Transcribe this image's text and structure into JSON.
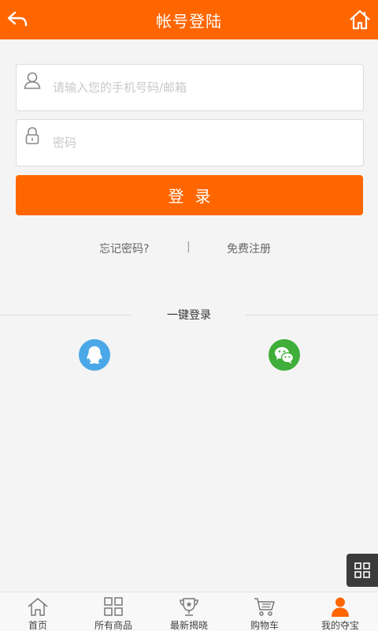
{
  "header": {
    "title": "帐号登陆",
    "back_icon": "back-arrow-icon",
    "home_icon": "home-icon"
  },
  "form": {
    "username": {
      "value": "",
      "placeholder": "请输入您的手机号码/邮箱",
      "icon": "user-icon"
    },
    "password": {
      "value": "",
      "placeholder": "密码",
      "icon": "lock-icon"
    },
    "login_label": "登录"
  },
  "links": {
    "forgot_label": "忘记密码?",
    "separator": "|",
    "register_label": "免费注册"
  },
  "social": {
    "title": "一键登录",
    "providers": [
      {
        "name": "qq",
        "icon": "qq-icon",
        "color": "#4aa8e8"
      },
      {
        "name": "wechat",
        "icon": "wechat-icon",
        "color": "#3fae3a"
      }
    ]
  },
  "floating": {
    "icon": "grid-icon"
  },
  "tabbar": {
    "items": [
      {
        "label": "首页",
        "icon": "home-outline-icon"
      },
      {
        "label": "所有商品",
        "icon": "grid-outline-icon"
      },
      {
        "label": "最新揭晓",
        "icon": "trophy-icon"
      },
      {
        "label": "购物车",
        "icon": "cart-icon"
      },
      {
        "label": "我的夺宝",
        "icon": "person-icon",
        "active": true
      }
    ]
  },
  "colors": {
    "accent": "#ff6600",
    "background": "#f4f4f4",
    "qq": "#4aa8e8",
    "wechat": "#3fae3a"
  }
}
